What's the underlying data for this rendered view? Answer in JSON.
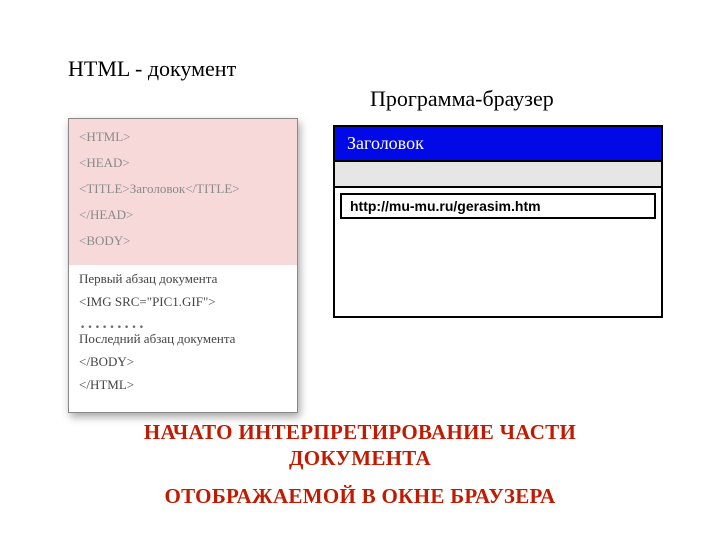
{
  "headings": {
    "left": "HTML - документ",
    "right": "Программа-браузер"
  },
  "code": {
    "highlighted": [
      "<HTML>",
      "<HEAD>",
      "<TITLE>Заголовок</TITLE>",
      "</HEAD>",
      "<BODY>"
    ],
    "body_pre": [
      "Первый абзац документа",
      "<IMG SRC=\"PIC1.GIF\">"
    ],
    "dots": "………",
    "body_post": [
      "Последний абзац документа",
      "</BODY>",
      "</HTML>"
    ]
  },
  "browser": {
    "title": "Заголовок",
    "url": "http://mu-mu.ru/gerasim.htm"
  },
  "caption": {
    "line1": "НАЧАТО ИНТЕРПРЕТИРОВАНИЕ ЧАСТИ",
    "line2": "ДОКУМЕНТА",
    "line3": "ОТОБРАЖАЕМОЙ В ОКНЕ БРАУЗЕРА"
  }
}
